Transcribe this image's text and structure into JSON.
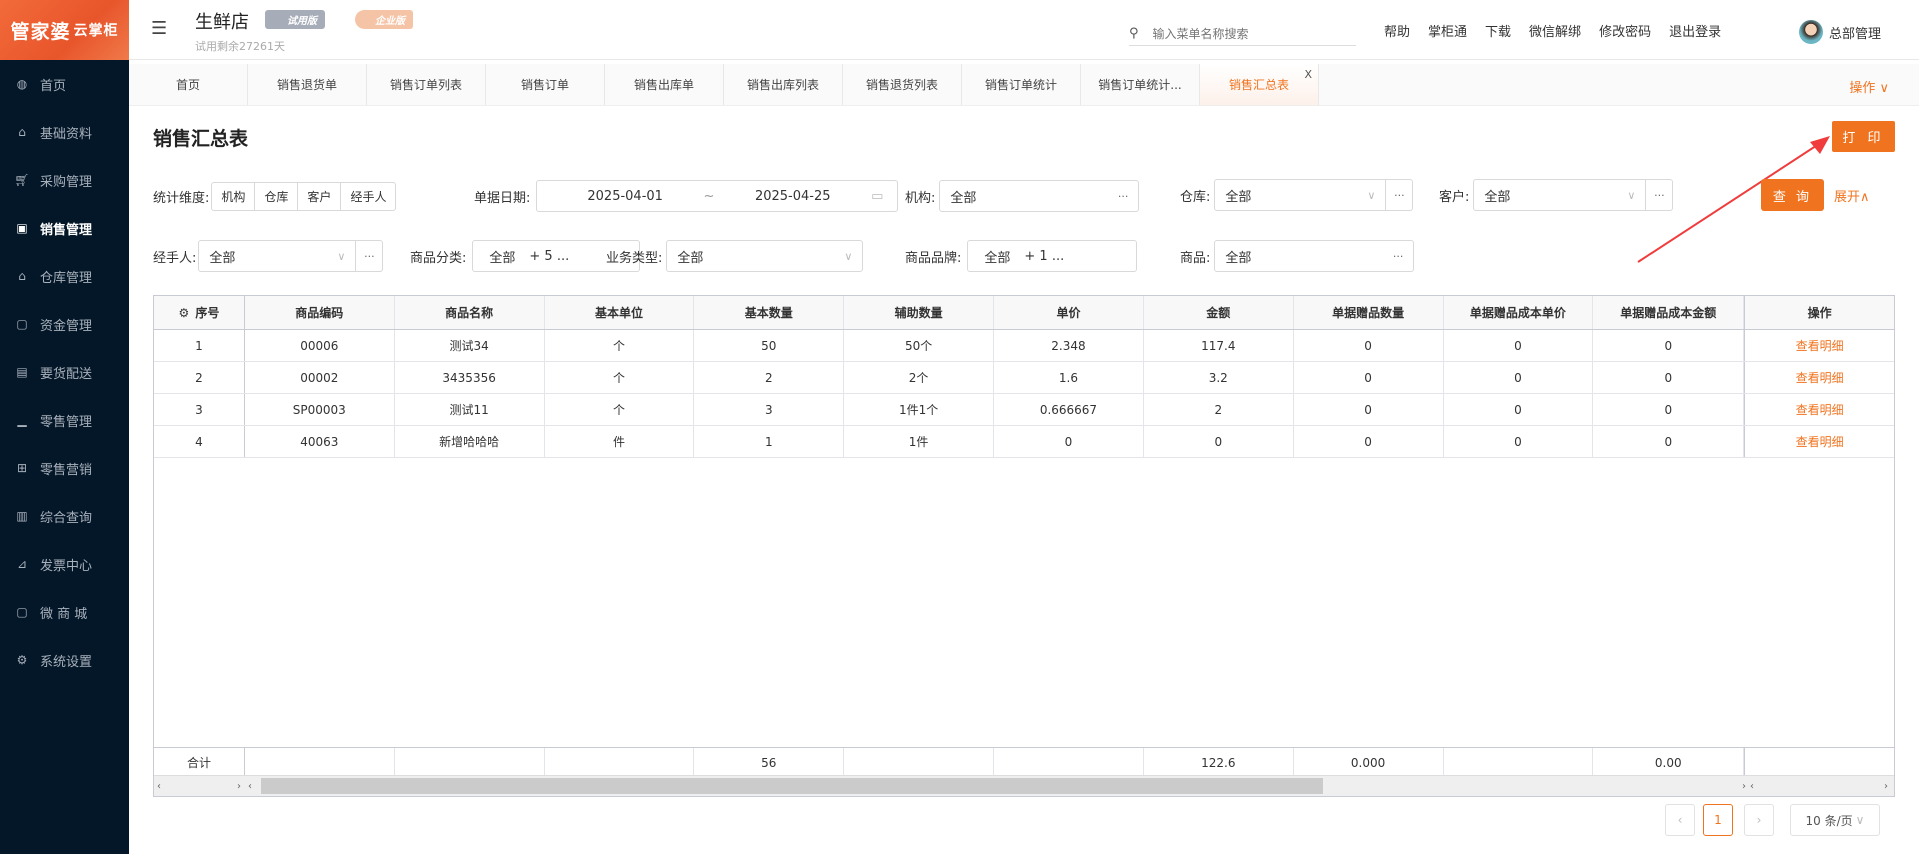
{
  "sidebar": {
    "logo": "管家婆",
    "logo_sub": "云掌柜",
    "items": [
      {
        "label": "首页",
        "icon": "globe-icon"
      },
      {
        "label": "基础资料",
        "icon": "home-icon"
      },
      {
        "label": "采购管理",
        "icon": "cart-icon"
      },
      {
        "label": "销售管理",
        "icon": "calendar-check-icon",
        "active": true
      },
      {
        "label": "仓库管理",
        "icon": "bank-icon"
      },
      {
        "label": "资金管理",
        "icon": "money-icon"
      },
      {
        "label": "要货配送",
        "icon": "list-icon"
      },
      {
        "label": "零售管理",
        "icon": "area-chart-icon"
      },
      {
        "label": "零售营销",
        "icon": "gift-icon"
      },
      {
        "label": "综合查询",
        "icon": "bar-chart-icon"
      },
      {
        "label": "发票中心",
        "icon": "line-chart-icon"
      },
      {
        "label": "微 商 城",
        "icon": "bag-icon"
      },
      {
        "label": "系统设置",
        "icon": "gear-icon"
      }
    ]
  },
  "header": {
    "shop": "生鲜店",
    "trial_badge": "试用版",
    "enterprise_badge": "企业版",
    "trial_left": "试用剩余27261天",
    "search_placeholder": "输入菜单名称搜索",
    "links": [
      "帮助",
      "掌柜通",
      "下载",
      "微信解绑",
      "修改密码",
      "退出登录"
    ],
    "user": "总部管理"
  },
  "tabs": [
    {
      "label": "首页"
    },
    {
      "label": "销售退货单"
    },
    {
      "label": "销售订单列表"
    },
    {
      "label": "销售订单"
    },
    {
      "label": "销售出库单"
    },
    {
      "label": "销售出库列表"
    },
    {
      "label": "销售退货列表"
    },
    {
      "label": "销售订单统计"
    },
    {
      "label": "销售订单统计..."
    },
    {
      "label": "销售汇总表",
      "active": true
    }
  ],
  "tab_close": "X",
  "ops_label": "操作 ∨",
  "page": {
    "title": "销售汇总表",
    "print": "打 印"
  },
  "filters": {
    "dim_label": "统计维度:",
    "dims": [
      "机构",
      "仓库",
      "客户",
      "经手人"
    ],
    "date_label": "单据日期:",
    "date_from": "2025-04-01",
    "date_sep": "~",
    "date_to": "2025-04-25",
    "org_label": "机构:",
    "org": "全部",
    "wh_label": "仓库:",
    "wh": "全部",
    "cust_label": "客户:",
    "cust": "全部",
    "handler_label": "经手人:",
    "handler": "全部",
    "cat_label": "商品分类:",
    "cat": "全部",
    "cat_more": "+ 5 ...",
    "biz_label": "业务类型:",
    "biz": "全部",
    "brand_label": "商品品牌:",
    "brand": "全部",
    "brand_more": "+ 1 ...",
    "goods_label": "商品:",
    "goods": "全部",
    "query": "查 询",
    "expand": "展开∧"
  },
  "table": {
    "headers": [
      "序号",
      "商品编码",
      "商品名称",
      "基本单位",
      "基本数量",
      "辅助数量",
      "单价",
      "金额",
      "单据赠品数量",
      "单据赠品成本单价",
      "单据赠品成本金额",
      "操作"
    ],
    "rows": [
      [
        "1",
        "00006",
        "测试34",
        "个",
        "50",
        "50个",
        "2.348",
        "117.4",
        "0",
        "0",
        "0",
        "查看明细"
      ],
      [
        "2",
        "00002",
        "3435356",
        "个",
        "2",
        "2个",
        "1.6",
        "3.2",
        "0",
        "0",
        "0",
        "查看明细"
      ],
      [
        "3",
        "SP00003",
        "测试11",
        "个",
        "3",
        "1件1个",
        "0.666667",
        "2",
        "0",
        "0",
        "0",
        "查看明细"
      ],
      [
        "4",
        "40063",
        "新增哈哈哈",
        "件",
        "1",
        "1件",
        "0",
        "0",
        "0",
        "0",
        "0",
        "查看明细"
      ]
    ],
    "total": [
      "合计",
      "",
      "",
      "",
      "56",
      "",
      "",
      "122.6",
      "0.000",
      "",
      "0.00",
      ""
    ]
  },
  "pagination": {
    "prev": "‹",
    "page": "1",
    "next": "›",
    "size": "10 条/页"
  }
}
